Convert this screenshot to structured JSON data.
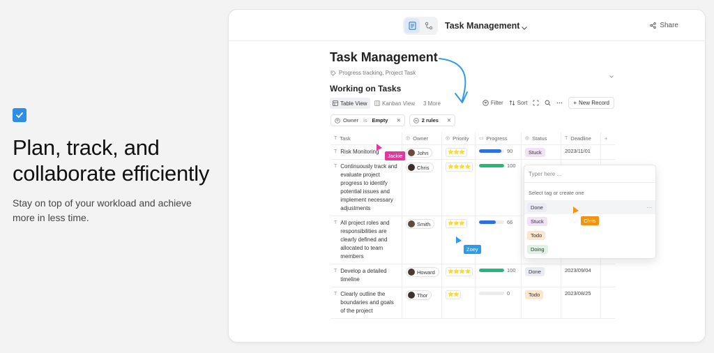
{
  "hero": {
    "headline": "Plan, track, and collaborate efficiently",
    "subtitle": "Stay on top of your workload and achieve more in less time."
  },
  "topbar": {
    "title": "Task Management",
    "share_label": "Share"
  },
  "document": {
    "title": "Task Management",
    "meta": "Progress tracking, Project Task",
    "section_title": "Working on Tasks"
  },
  "views": {
    "tabs": [
      {
        "label": "Table View",
        "active": true
      },
      {
        "label": "Kanban View",
        "active": false
      },
      {
        "label": "3 More",
        "active": false
      }
    ],
    "filter_label": "Filter",
    "sort_label": "Sort",
    "new_record_label": "New Record"
  },
  "filters": {
    "owner": {
      "field": "Owner",
      "op": "is",
      "value": "Empty"
    },
    "rules": "2 rules"
  },
  "table": {
    "columns": [
      "Task",
      "Owner",
      "Priority",
      "Progress",
      "Status",
      "Deadline"
    ],
    "rows": [
      {
        "task": "Risk Monitoring",
        "owner": "John",
        "stars": "⭐⭐⭐",
        "progress": "90",
        "progress_color": "#2f6fe4",
        "status": "Stuck",
        "status_color": "#f1e3f7",
        "deadline": "2023/11/01"
      },
      {
        "task": "Continuously track and evaluate project progress to identify potential issues and implement necessary adjustments",
        "owner": "Chris",
        "stars": "⭐⭐⭐⭐",
        "progress": "100",
        "progress_color": "#27b77a",
        "status": "",
        "status_color": "",
        "deadline": ""
      },
      {
        "task": "All project roles and responsibilities are clearly defined and allocated to team members",
        "owner": "Smith",
        "stars": "⭐⭐⭐",
        "progress": "66",
        "progress_color": "#2f6fe4",
        "status": "",
        "status_color": "",
        "deadline": ""
      },
      {
        "task": "Develop a detailed timeline",
        "owner": "Howard",
        "stars": "⭐⭐⭐⭐",
        "progress": "100",
        "progress_color": "#27b77a",
        "status": "Done",
        "status_color": "#e9ecf5",
        "deadline": "2023/09/04"
      },
      {
        "task": "Clearly outline the boundaries and goals of the project",
        "owner": "Thor",
        "stars": "⭐⭐",
        "progress": "0",
        "progress_color": "#ececec",
        "status": "Todo",
        "status_color": "#fbe6cf",
        "deadline": "2023/08/25"
      }
    ]
  },
  "dropdown": {
    "placeholder": "Typer here ...",
    "hint": "Select tag or create one",
    "options": [
      {
        "label": "Done",
        "color": "#e9ecf5"
      },
      {
        "label": "Stuck",
        "color": "#f1e3f7"
      },
      {
        "label": "Todo",
        "color": "#fbe6cf"
      },
      {
        "label": "Doing",
        "color": "#dff2e6"
      }
    ],
    "more": "···"
  },
  "cursors": {
    "jackie": {
      "name": "Jackie",
      "color": "#e2379f"
    },
    "zoey": {
      "name": "Zoey",
      "color": "#2e9be6"
    },
    "chris": {
      "name": "Chris",
      "color": "#f29411"
    }
  },
  "colors": {
    "accent": "#2e8de6",
    "page_bg": "#f3f3f3"
  }
}
